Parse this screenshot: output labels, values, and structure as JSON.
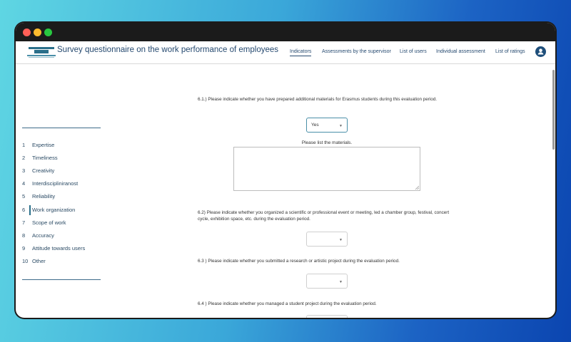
{
  "header": {
    "title": "Survey questionnaire on the work performance of employees",
    "nav": [
      {
        "label": "Indicators",
        "active": true
      },
      {
        "label": "Assessments by the supervisor",
        "active": false
      },
      {
        "label": "List of users",
        "active": false
      },
      {
        "label": "Individual assessment",
        "active": false
      },
      {
        "label": "List of ratings",
        "active": false
      }
    ]
  },
  "sidebar": {
    "items": [
      {
        "num": "1",
        "label": "Expertise"
      },
      {
        "num": "2",
        "label": "Timeliness"
      },
      {
        "num": "3",
        "label": "Creativity"
      },
      {
        "num": "4",
        "label": "Interdiscipliniranost"
      },
      {
        "num": "5",
        "label": "Reliability"
      },
      {
        "num": "6",
        "label": "Work organization",
        "active": true
      },
      {
        "num": "7",
        "label": "Scope of work"
      },
      {
        "num": "8",
        "label": "Accuracy"
      },
      {
        "num": "9",
        "label": "Attitude towards users"
      },
      {
        "num": "10",
        "label": "Other"
      }
    ]
  },
  "questions": [
    {
      "text": "6.1.) Please indicate whether you have prepared additional materials for Erasmus students during this evaluation period.",
      "selected": "Yes"
    },
    {
      "text": "6.2) Please indicate whether you organized a scientific or professional event or meeting, led a chamber group, festival, concert cycle, exhibition space, etc. during the evaluation period.",
      "selected": ""
    },
    {
      "text": "6.3 ) Please indicate whether you submitted a research or artistic project during the evaluation period.",
      "selected": ""
    },
    {
      "text": "6.4 ) Please indicate whether you managed a student project during the evaluation period.",
      "selected": ""
    }
  ],
  "materials_label": "Please list the materials.",
  "colors": {
    "accent": "#264a70",
    "brand": "#2a6f8a"
  },
  "icons": {
    "avatar": "user-avatar-icon",
    "select": "chevron-down-icon"
  }
}
